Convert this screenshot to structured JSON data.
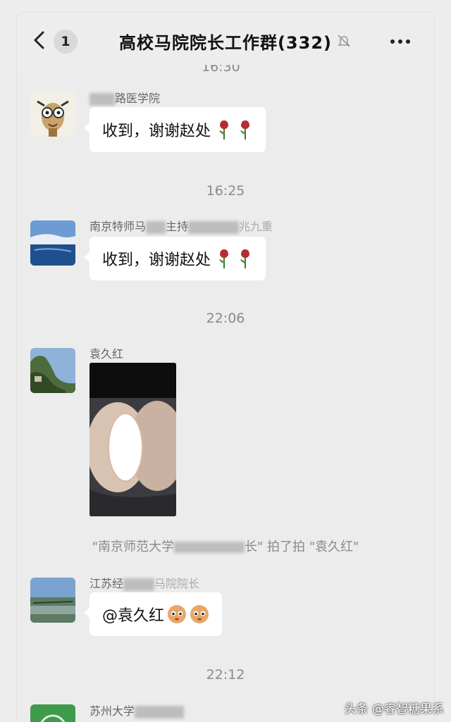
{
  "header": {
    "back_label": "<",
    "unread_count": "1",
    "title": "高校马院院长工作群(332)",
    "mute_icon": "bell-off-icon",
    "more_icon": "more-dots-icon"
  },
  "colors": {
    "background": "#ededed",
    "bubble": "#ffffff",
    "timestamp": "#8a8a8a"
  },
  "messages": [
    {
      "sender": "路医学院",
      "text": "收到，谢谢赵处",
      "emoji": [
        "rose-icon",
        "rose-icon"
      ]
    },
    {
      "time": "16:25",
      "sender_prefix": "南京特师马",
      "sender_mid": "主持",
      "sender_suffix": "兆九重",
      "text": "收到，谢谢赵处",
      "emoji": [
        "rose-icon",
        "rose-icon"
      ]
    },
    {
      "time": "22:06",
      "sender": "袁久红",
      "attachment": "image"
    },
    {
      "system": {
        "prefix": "\"南京师范大学",
        "suffix": "长\" 拍了拍 \"袁久红\""
      }
    },
    {
      "sender": "江苏经",
      "sender_suffix": "马院院长",
      "text": "@袁久红",
      "emoji": [
        "face-emoji-icon",
        "face-emoji-icon"
      ]
    },
    {
      "time": "22:12",
      "sender": "苏州大学"
    }
  ],
  "watermark": "头条 @睿智糖果系"
}
